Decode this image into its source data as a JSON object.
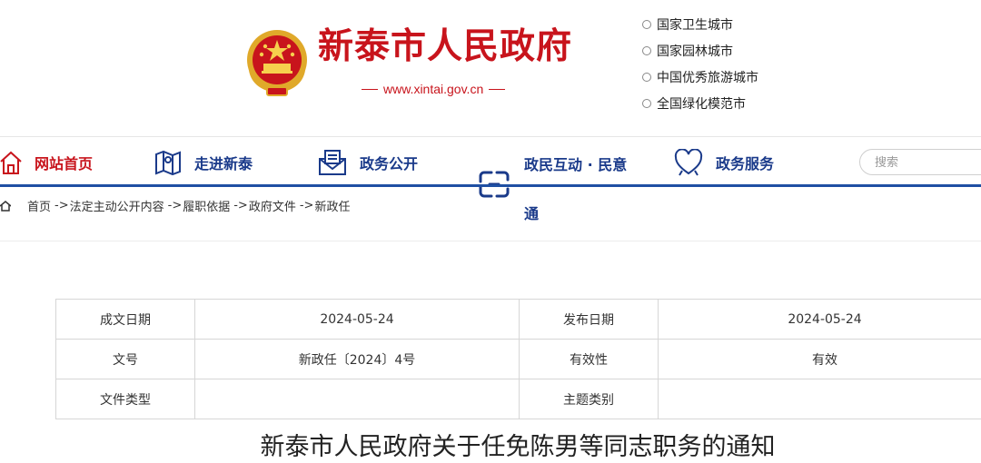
{
  "header": {
    "site_title": "新泰市人民政府",
    "site_url": "www.xintai.gov.cn",
    "honors": [
      "国家卫生城市",
      "国家园林城市",
      "中国优秀旅游城市",
      "全国绿化模范市"
    ]
  },
  "nav": {
    "items": [
      {
        "label": "网站首页",
        "icon": "home-icon"
      },
      {
        "label": "走进新泰",
        "icon": "map-icon"
      },
      {
        "label": "政务公开",
        "icon": "mail-icon"
      },
      {
        "label": "政民互动 · 民意",
        "label_wrap": "通",
        "icon": "link-icon"
      },
      {
        "label": "政务服务",
        "icon": "heart-icon"
      }
    ],
    "search_placeholder": "搜索"
  },
  "breadcrumb": {
    "items": [
      "首页",
      "法定主动公开内容",
      "履职依据",
      "政府文件",
      "新政任"
    ],
    "separator": "->"
  },
  "info_table": {
    "rows": [
      [
        {
          "label": "成文日期",
          "value": "2024-05-24"
        },
        {
          "label": "发布日期",
          "value": "2024-05-24"
        }
      ],
      [
        {
          "label": "文号",
          "value": "新政任〔2024〕4号"
        },
        {
          "label": "有效性",
          "value": "有效"
        }
      ],
      [
        {
          "label": "文件类型",
          "value": ""
        },
        {
          "label": "主题类别",
          "value": ""
        }
      ]
    ]
  },
  "article": {
    "title": "新泰市人民政府关于任免陈男等同志职务的通知"
  },
  "colors": {
    "brand_red": "#c8141c",
    "nav_blue": "#1a3a8a",
    "bar_blue": "#1f4fa3"
  }
}
